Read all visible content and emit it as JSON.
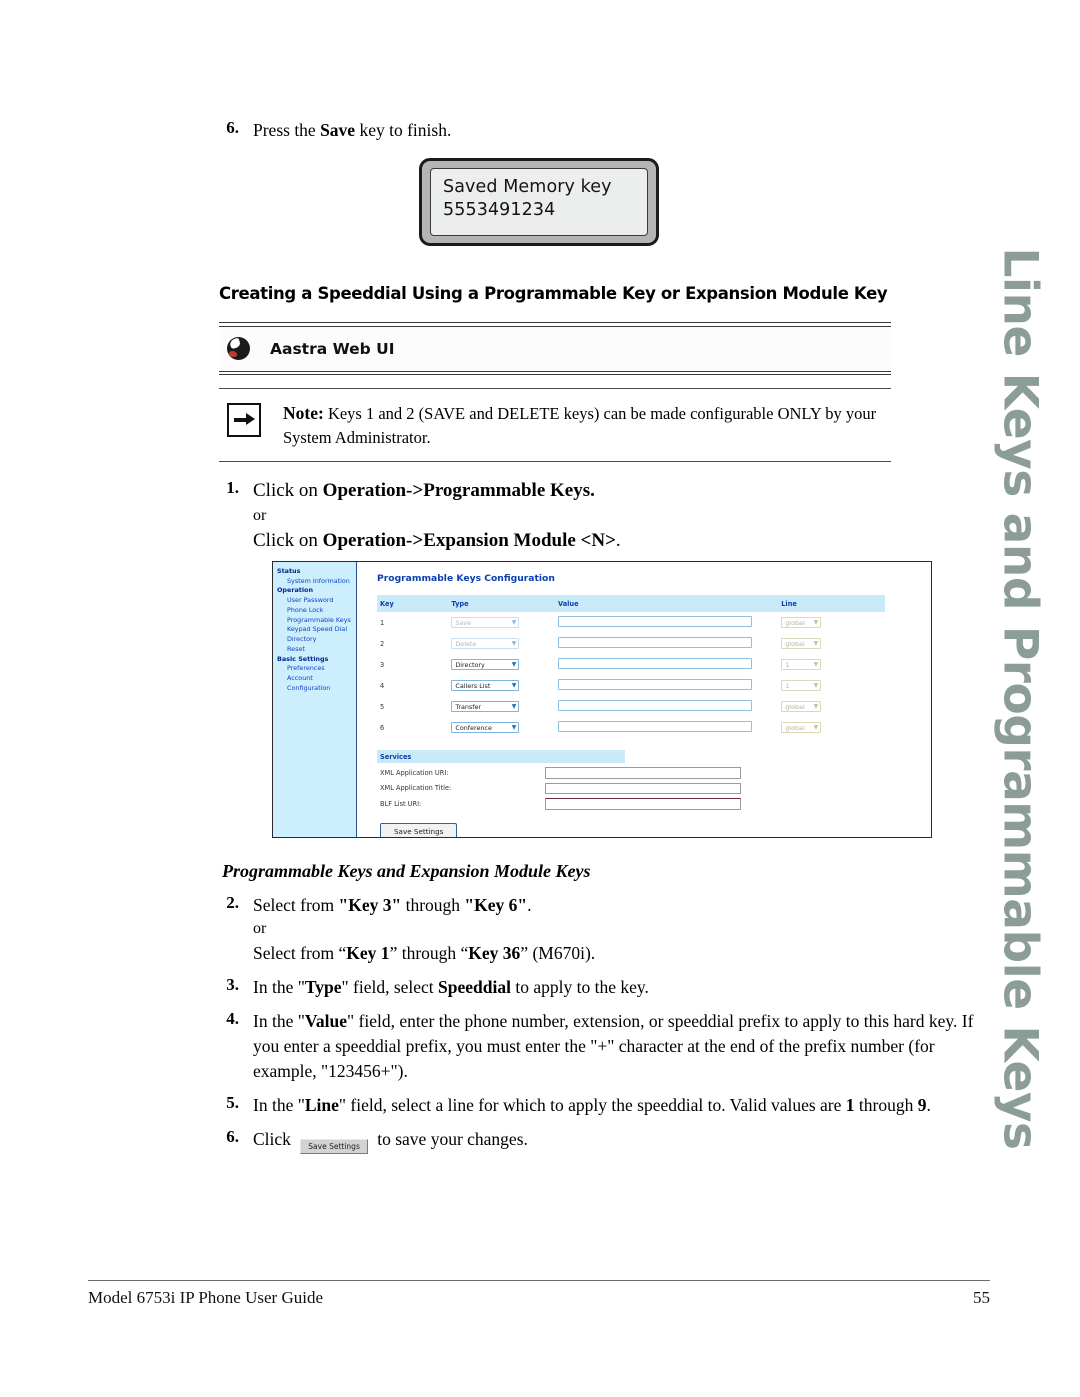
{
  "document": {
    "footer_title": "Model 6753i IP Phone User Guide",
    "page_number": "55",
    "side_tab": "Line Keys and Programmable Keys"
  },
  "top_step": {
    "number": "6.",
    "text_before": "Press the ",
    "bold": "Save",
    "text_after": " key to finish."
  },
  "lcd": {
    "line1": "Saved Memory key",
    "line2": "5553491234"
  },
  "section_heading": "Creating a Speeddial Using a Programmable Key or Expansion Module Key",
  "webui_band": {
    "icon": "aastra-globe-icon",
    "label": "Aastra Web UI"
  },
  "note": {
    "icon": "arrow-right-icon",
    "label": "Note:",
    "text": " Keys 1 and 2 (SAVE and DELETE keys) can be made configurable ONLY by your System Administrator."
  },
  "step1": {
    "number": "1.",
    "line1_prefix": "Click on ",
    "line1_bold": "Operation->Programmable Keys.",
    "or": "or",
    "line2_prefix": "Click on ",
    "line2_bold": "Operation->Expansion Module <N>",
    "line2_suffix": "."
  },
  "webshot": {
    "sidebar": [
      {
        "type": "section",
        "label": "Status"
      },
      {
        "type": "item",
        "label": "System Information"
      },
      {
        "type": "section",
        "label": "Operation"
      },
      {
        "type": "item",
        "label": "User Password"
      },
      {
        "type": "item",
        "label": "Phone Lock"
      },
      {
        "type": "item",
        "label": "Programmable Keys"
      },
      {
        "type": "item",
        "label": "Keypad Speed Dial"
      },
      {
        "type": "item",
        "label": "Directory"
      },
      {
        "type": "item",
        "label": "Reset"
      },
      {
        "type": "section",
        "label": "Basic Settings"
      },
      {
        "type": "item",
        "label": "Preferences"
      },
      {
        "type": "item",
        "label": "Account Configuration"
      }
    ],
    "title": "Programmable Keys Configuration",
    "columns": [
      "Key",
      "Type",
      "Value",
      "Line"
    ],
    "rows": [
      {
        "key": "1",
        "type": "Save",
        "value": "",
        "line": "global",
        "disabled": true
      },
      {
        "key": "2",
        "type": "Delete",
        "value": "",
        "line": "global",
        "disabled": true
      },
      {
        "key": "3",
        "type": "Directory",
        "value": "",
        "line": "1",
        "disabled": false
      },
      {
        "key": "4",
        "type": "Callers List",
        "value": "",
        "line": "1",
        "disabled": false
      },
      {
        "key": "5",
        "type": "Transfer",
        "value": "",
        "line": "global",
        "disabled": false
      },
      {
        "key": "6",
        "type": "Conference",
        "value": "",
        "line": "global",
        "disabled": false
      }
    ],
    "services_header": "Services",
    "services": [
      {
        "label": "XML Application URI:",
        "value": ""
      },
      {
        "label": "XML Application Title:",
        "value": ""
      },
      {
        "label": "BLF List URI:",
        "value": ""
      }
    ],
    "save_button": "Save Settings"
  },
  "sub_italic": "Programmable Keys and Expansion Module Keys",
  "steps": {
    "s2": {
      "number": "2.",
      "l1_a": "Select from ",
      "l1_b": "\"Key 3\"",
      "l1_c": " through ",
      "l1_d": "\"Key 6\"",
      "l1_e": ".",
      "or": "or",
      "l2_a": "Select from “",
      "l2_b": "Key 1",
      "l2_c": "” through “",
      "l2_d": "Key 36",
      "l2_e": "” (M670i)."
    },
    "s3": {
      "number": "3.",
      "a": "In the \"",
      "b": "Type",
      "c": "\" field, select ",
      "d": "Speeddial",
      "e": " to apply to the key."
    },
    "s4": {
      "number": "4.",
      "a": "In the \"",
      "b": "Value",
      "c": "\" field, enter the phone number, extension, or speeddial prefix to apply to this hard key. If you enter a speeddial prefix, you must enter the \"+\" character at the end of the prefix number (for example, \"123456+\")."
    },
    "s5": {
      "number": "5.",
      "a": "In the \"",
      "b": "Line",
      "c": "\" field, select a line for which to apply the speeddial to. Valid values are ",
      "d": "1",
      "e": " through ",
      "f": "9",
      "g": "."
    },
    "s6": {
      "number": "6.",
      "a": "Click ",
      "chip": "Save Settings",
      "b": " to save your changes."
    }
  }
}
